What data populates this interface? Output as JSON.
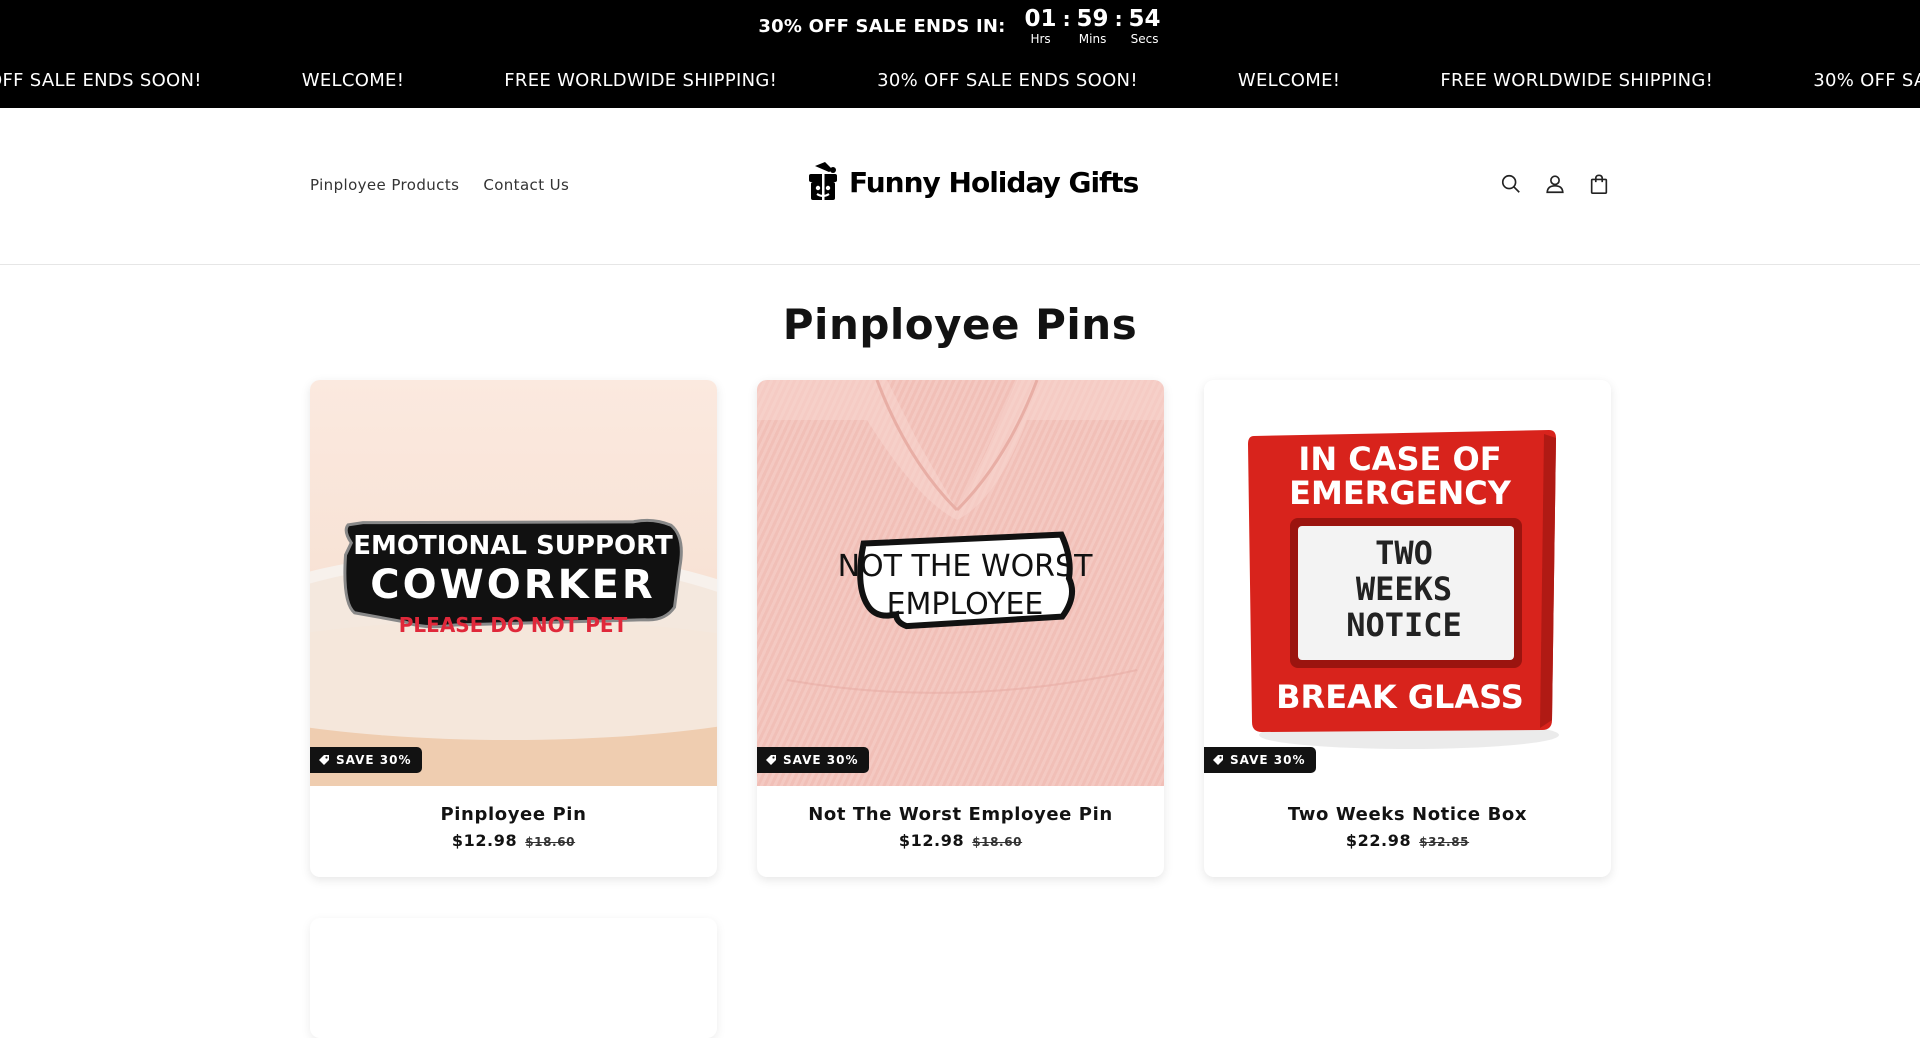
{
  "announcement": {
    "text": "30% OFF SALE ENDS IN:",
    "timer": [
      {
        "value": "01",
        "label": "Hrs"
      },
      {
        "value": "59",
        "label": "Mins"
      },
      {
        "value": "54",
        "label": "Secs"
      }
    ],
    "separator": ":"
  },
  "marquee": [
    "OFF SALE ENDS SOON!",
    "WELCOME!",
    "FREE WORLDWIDE SHIPPING!",
    "30% OFF SALE ENDS SOON!",
    "WELCOME!",
    "FREE WORLDWIDE SHIPPING!",
    "30% OFF SALE"
  ],
  "header": {
    "nav": [
      "Pinployee Products",
      "Contact Us"
    ],
    "logo_text": "Funny Holiday Gifts",
    "icons": [
      "search-icon",
      "account-icon",
      "cart-icon"
    ]
  },
  "main": {
    "title": "Pinployee Pins",
    "products": [
      {
        "name": "Pinployee Pin",
        "price": "$12.98",
        "compare_price": "$18.60",
        "badge": "SAVE 30%",
        "image_lines": [
          "EMOTIONAL SUPPORT",
          "COWORKER",
          "PLEASE DO NOT PET"
        ]
      },
      {
        "name": "Not The Worst Employee Pin",
        "price": "$12.98",
        "compare_price": "$18.60",
        "badge": "SAVE 30%",
        "image_lines": [
          "NOT THE WORST",
          "EMPLOYEE"
        ]
      },
      {
        "name": "Two Weeks Notice Box",
        "price": "$22.98",
        "compare_price": "$32.85",
        "badge": "SAVE 30%",
        "image_lines": [
          "IN CASE OF",
          "EMERGENCY",
          "TWO",
          "WEEKS",
          "NOTICE",
          "BREAK GLASS"
        ]
      }
    ]
  },
  "colors": {
    "bar_bg": "#000000",
    "text": "#121212",
    "badge_bg": "#121212",
    "box_red": "#d8231c",
    "pin_red_text": "#e0283a"
  }
}
